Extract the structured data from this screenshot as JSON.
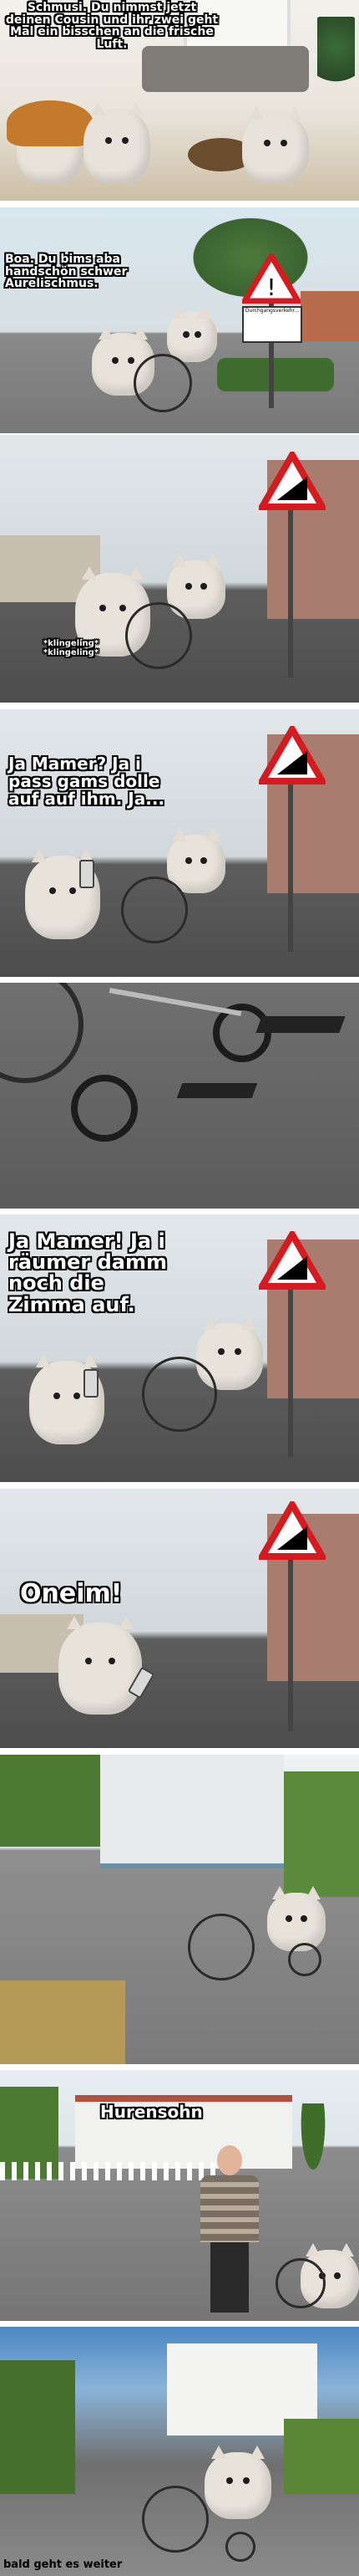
{
  "panels": [
    {
      "caption": "Schmusi. Du nimmst jetzt deinen Cousin und ihr zwei geht Mal ein bisschen an die frische Luft."
    },
    {
      "caption": "Boa. Du bims aba handschön schwer Aurelischmus.",
      "sign_text": "Durchgangsverkehr..."
    },
    {
      "caption": "*klingeling*\n*klingeling*"
    },
    {
      "caption": "Ja Mamer? Ja i pass  gams dolle auf auf ihm. Ja..."
    },
    {
      "caption": ""
    },
    {
      "caption": "Ja Mamer! Ja i räumer damm noch die Zimma auf."
    },
    {
      "caption": "Oneim!"
    },
    {
      "caption": ""
    },
    {
      "caption": "Hurensohn"
    },
    {
      "caption": "bald geht es weiter"
    }
  ],
  "colors": {
    "sky": "#cfe0ea",
    "road": "#6e6e6e",
    "sign_red": "#d71920",
    "cat": "#e7e2da"
  },
  "icons": [
    "warning-sign-icon",
    "wheelchair-icon",
    "phone-icon",
    "cat-icon"
  ]
}
